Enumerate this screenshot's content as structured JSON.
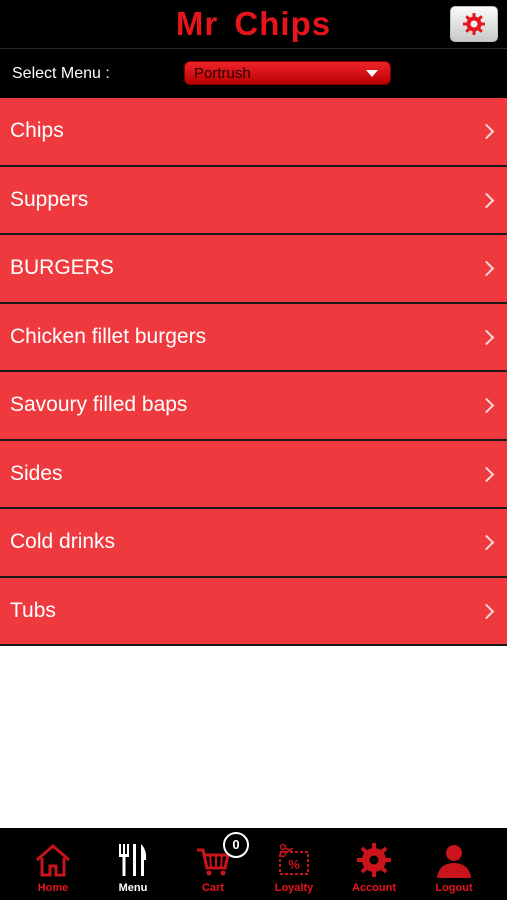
{
  "header": {
    "title": "Mr  Chips",
    "settings_icon": "gear-icon"
  },
  "select_menu": {
    "label": "Select Menu :",
    "value": "Portrush"
  },
  "menu_items": [
    {
      "label": "Chips"
    },
    {
      "label": "Suppers"
    },
    {
      "label": "BURGERS"
    },
    {
      "label": "Chicken fillet burgers"
    },
    {
      "label": "Savoury filled baps"
    },
    {
      "label": "Sides"
    },
    {
      "label": "Cold drinks"
    },
    {
      "label": "Tubs"
    }
  ],
  "tabbar": {
    "tabs": [
      {
        "label": "Home",
        "icon": "home-icon"
      },
      {
        "label": "Menu",
        "icon": "fork-knife-icon",
        "active": true
      },
      {
        "label": "Cart",
        "icon": "cart-icon"
      },
      {
        "label": "Loyalty",
        "icon": "coupon-icon"
      },
      {
        "label": "Account",
        "icon": "gear-icon"
      },
      {
        "label": "Logout",
        "icon": "user-icon"
      }
    ],
    "cart_count": "0"
  },
  "colors": {
    "accent": "#e8141b",
    "row": "#ee3a3e",
    "bar": "#000000"
  }
}
